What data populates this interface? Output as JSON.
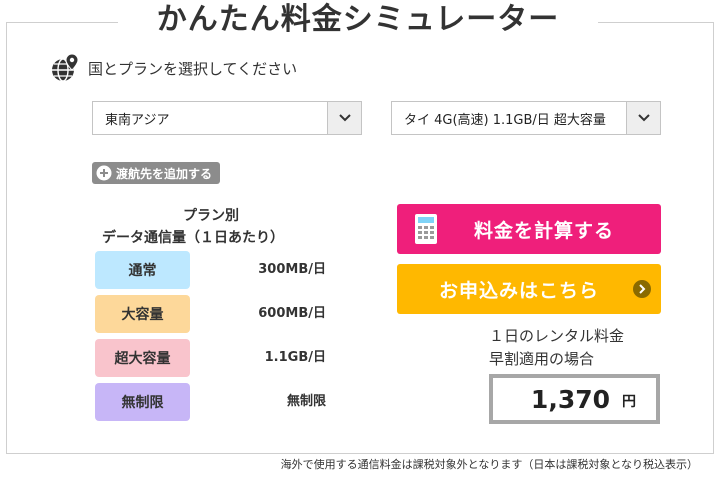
{
  "title": "かんたん料金シミュレーター",
  "section": {
    "label": "国とプランを選択してください",
    "icon": "globe-pin-icon"
  },
  "country_select": {
    "value": "東南アジア",
    "icon": "chevron-down-icon"
  },
  "plan_select": {
    "value": "タイ 4G(高速) 1.1GB/日 超大容量",
    "icon": "chevron-down-icon"
  },
  "add_destination": {
    "label": "渡航先を追加する",
    "icon": "plus-circle-icon"
  },
  "plan_table": {
    "heading_line1": "プラン別",
    "heading_line2": "データ通信量（１日あたり）",
    "rows": [
      {
        "name": "通常",
        "amount": "300MB/日",
        "color": "#bde8ff"
      },
      {
        "name": "大容量",
        "amount": "600MB/日",
        "color": "#fdd89a"
      },
      {
        "name": "超大容量",
        "amount": "1.1GB/日",
        "color": "#f9c4cc"
      },
      {
        "name": "無制限",
        "amount": "無制限",
        "color": "#c7b6f7"
      }
    ]
  },
  "calculate_button": {
    "label": "料金を計算する",
    "icon": "calculator-icon",
    "color": "#ef1f7b"
  },
  "apply_button": {
    "label": "お申込みはこちら",
    "icon": "arrow-right-circle-icon",
    "color": "#ffb800"
  },
  "rental_fee": {
    "label_line1": "１日のレンタル料金",
    "label_line2": "早割適用の場合",
    "amount": "1,370",
    "unit": "円"
  },
  "footnote": "海外で使用する通信料金は課税対象外となります（日本は課税対象となり税込表示）"
}
